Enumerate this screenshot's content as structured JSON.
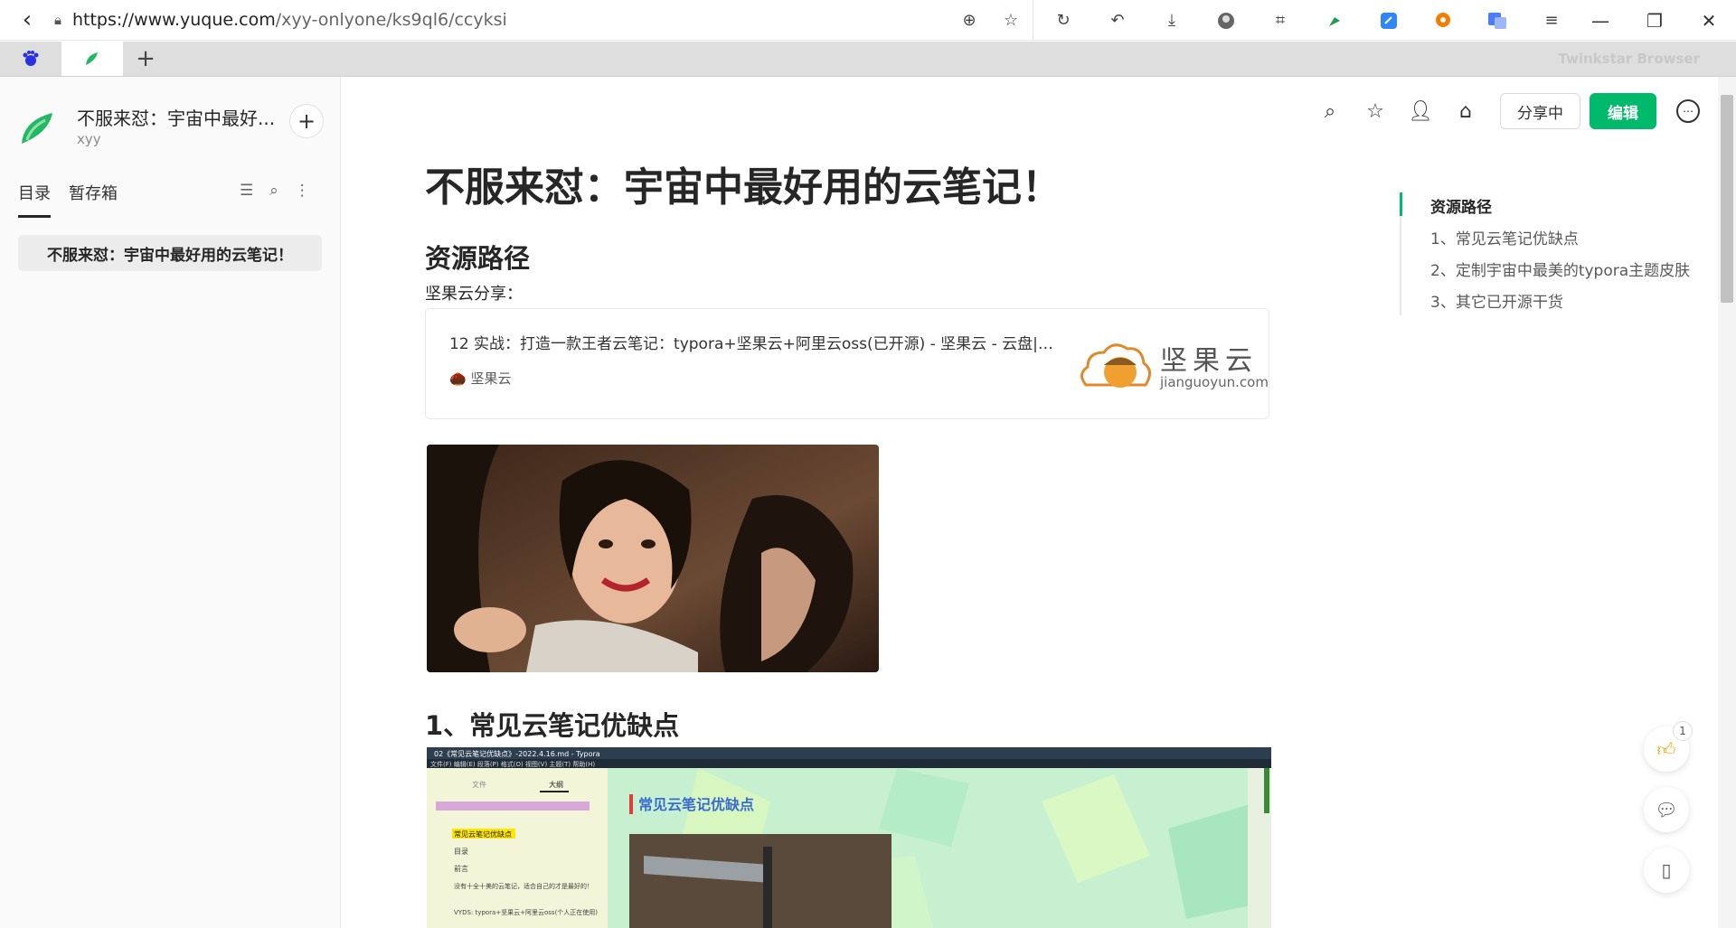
{
  "browser": {
    "url_host": "https://www.yuque.com",
    "url_path": "/xyy-onlyone/ks9ql6/ccyksi",
    "brand": "Twinkstar Browser"
  },
  "sidebar": {
    "book_title": "不服来怼：宇宙中最好...",
    "book_user": "xyy",
    "tabs": [
      "目录",
      "暂存箱"
    ],
    "toc_item": "不服来怼：宇宙中最好用的云笔记！"
  },
  "doc": {
    "share_label": "分享中",
    "edit_label": "编辑",
    "title": "不服来怼：宇宙中最好用的云笔记！",
    "section_resource": "资源路径",
    "share_text": "坚果云分享：",
    "card": {
      "title": "12 实战：打造一款王者云笔记：typora+坚果云+阿里云oss(已开源) - 坚果云 - 云盘|网...",
      "source": "坚果云",
      "logo_cn": "坚果云",
      "logo_en": "jianguoyun.com"
    },
    "section_1": "1、常见云笔记优缺点",
    "screenshot": {
      "window_title": "02《常见云笔记优缺点》-2022.4.16.md - Typora",
      "menu": "文件(F)  编辑(E)  段落(P)  格式(O)  视图(V)  主题(T)  帮助(H)",
      "panel_tabs": [
        "文件",
        "大纲"
      ],
      "outline_items": [
        "常见云笔记优缺点",
        "目录",
        "前言",
        "没有十全十美的云笔记，适合自己的才是最好的！",
        "VYDS: typora+坚果云+阿里云oss(个人正在使用)"
      ],
      "heading": "常见云笔记优缺点"
    }
  },
  "outline": {
    "items": [
      "资源路径",
      "1、常见云笔记优缺点",
      "2、定制宇宙中最美的typora主题皮肤",
      "3、其它已开源干货"
    ]
  },
  "float": {
    "like_count": "1"
  }
}
